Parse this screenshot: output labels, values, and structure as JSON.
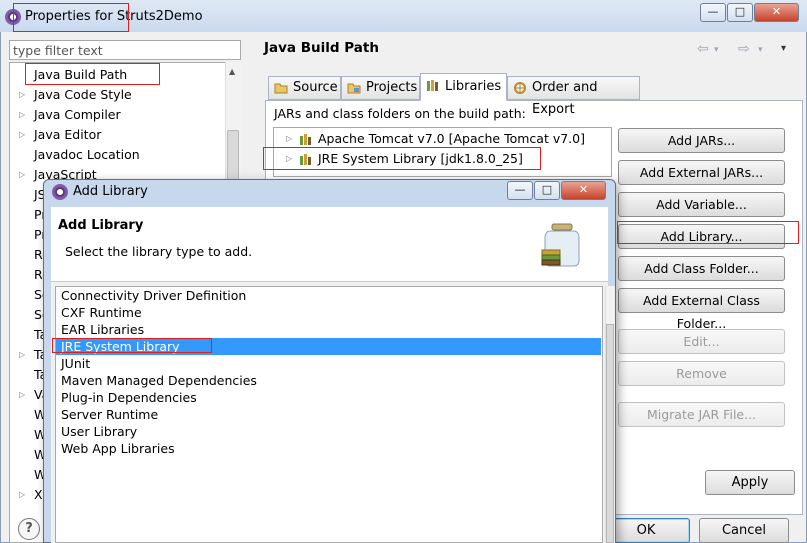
{
  "properties_window": {
    "title": "Properties for Struts2Demo",
    "buttons": {
      "minimize": "—",
      "maximize": "□",
      "close": "✕"
    },
    "filter": {
      "value": "",
      "placeholder": "type filter text"
    },
    "tree": [
      {
        "label": "Java Build Path",
        "expandable": false,
        "selected": true
      },
      {
        "label": "Java Code Style",
        "expandable": true
      },
      {
        "label": "Java Compiler",
        "expandable": true
      },
      {
        "label": "Java Editor",
        "expandable": true
      },
      {
        "label": "Javadoc Location",
        "expandable": false
      },
      {
        "label": "JavaScript",
        "expandable": true
      },
      {
        "label": "JS",
        "expandable": false
      },
      {
        "label": "Pr",
        "expandable": false
      },
      {
        "label": "Pr",
        "expandable": false
      },
      {
        "label": "Re",
        "expandable": false
      },
      {
        "label": "Re",
        "expandable": false
      },
      {
        "label": "Se",
        "expandable": false
      },
      {
        "label": "Se",
        "expandable": false
      },
      {
        "label": "Ta",
        "expandable": false
      },
      {
        "label": "Ta",
        "expandable": true
      },
      {
        "label": "Ta",
        "expandable": false
      },
      {
        "label": "Va",
        "expandable": true
      },
      {
        "label": "W",
        "expandable": false
      },
      {
        "label": "W",
        "expandable": false
      },
      {
        "label": "W",
        "expandable": false
      },
      {
        "label": "W",
        "expandable": false
      },
      {
        "label": "XI",
        "expandable": true
      }
    ],
    "page_title": "Java Build Path",
    "nav": {
      "back": "⇦",
      "forward": "⇨",
      "menu": "▾"
    },
    "tabs": [
      {
        "label": "Source"
      },
      {
        "label": "Projects"
      },
      {
        "label": "Libraries",
        "active": true
      },
      {
        "label": "Order and Export"
      }
    ],
    "jars_label": "JARs and class folders on the build path:",
    "libraries": [
      {
        "label": "Apache Tomcat v7.0 [Apache Tomcat v7.0]"
      },
      {
        "label": "JRE System Library [jdk1.8.0_25]"
      }
    ],
    "side_buttons": {
      "add_jars": "Add JARs...",
      "add_external_jars": "Add External JARs...",
      "add_variable": "Add Variable...",
      "add_library": "Add Library...",
      "add_class_folder": "Add Class Folder...",
      "add_external_class_folder": "Add External Class Folder...",
      "edit": "Edit...",
      "remove": "Remove",
      "migrate_jar": "Migrate JAR File..."
    },
    "apply": "Apply",
    "ok": "OK",
    "cancel": "Cancel",
    "help": "?"
  },
  "add_library_dialog": {
    "title": "Add Library",
    "buttons": {
      "minimize": "—",
      "maximize": "□",
      "close": "✕"
    },
    "heading": "Add Library",
    "description": "Select the library type to add.",
    "types": [
      "Connectivity Driver Definition",
      "CXF Runtime",
      "EAR Libraries",
      "JRE System Library",
      "JUnit",
      "Maven Managed Dependencies",
      "Plug-in Dependencies",
      "Server Runtime",
      "User Library",
      "Web App Libraries"
    ],
    "selected_index": 3
  },
  "colors": {
    "selection": "#3399ff",
    "annotation_red": "#e0201e",
    "titlebar": "#c9d9ee"
  }
}
